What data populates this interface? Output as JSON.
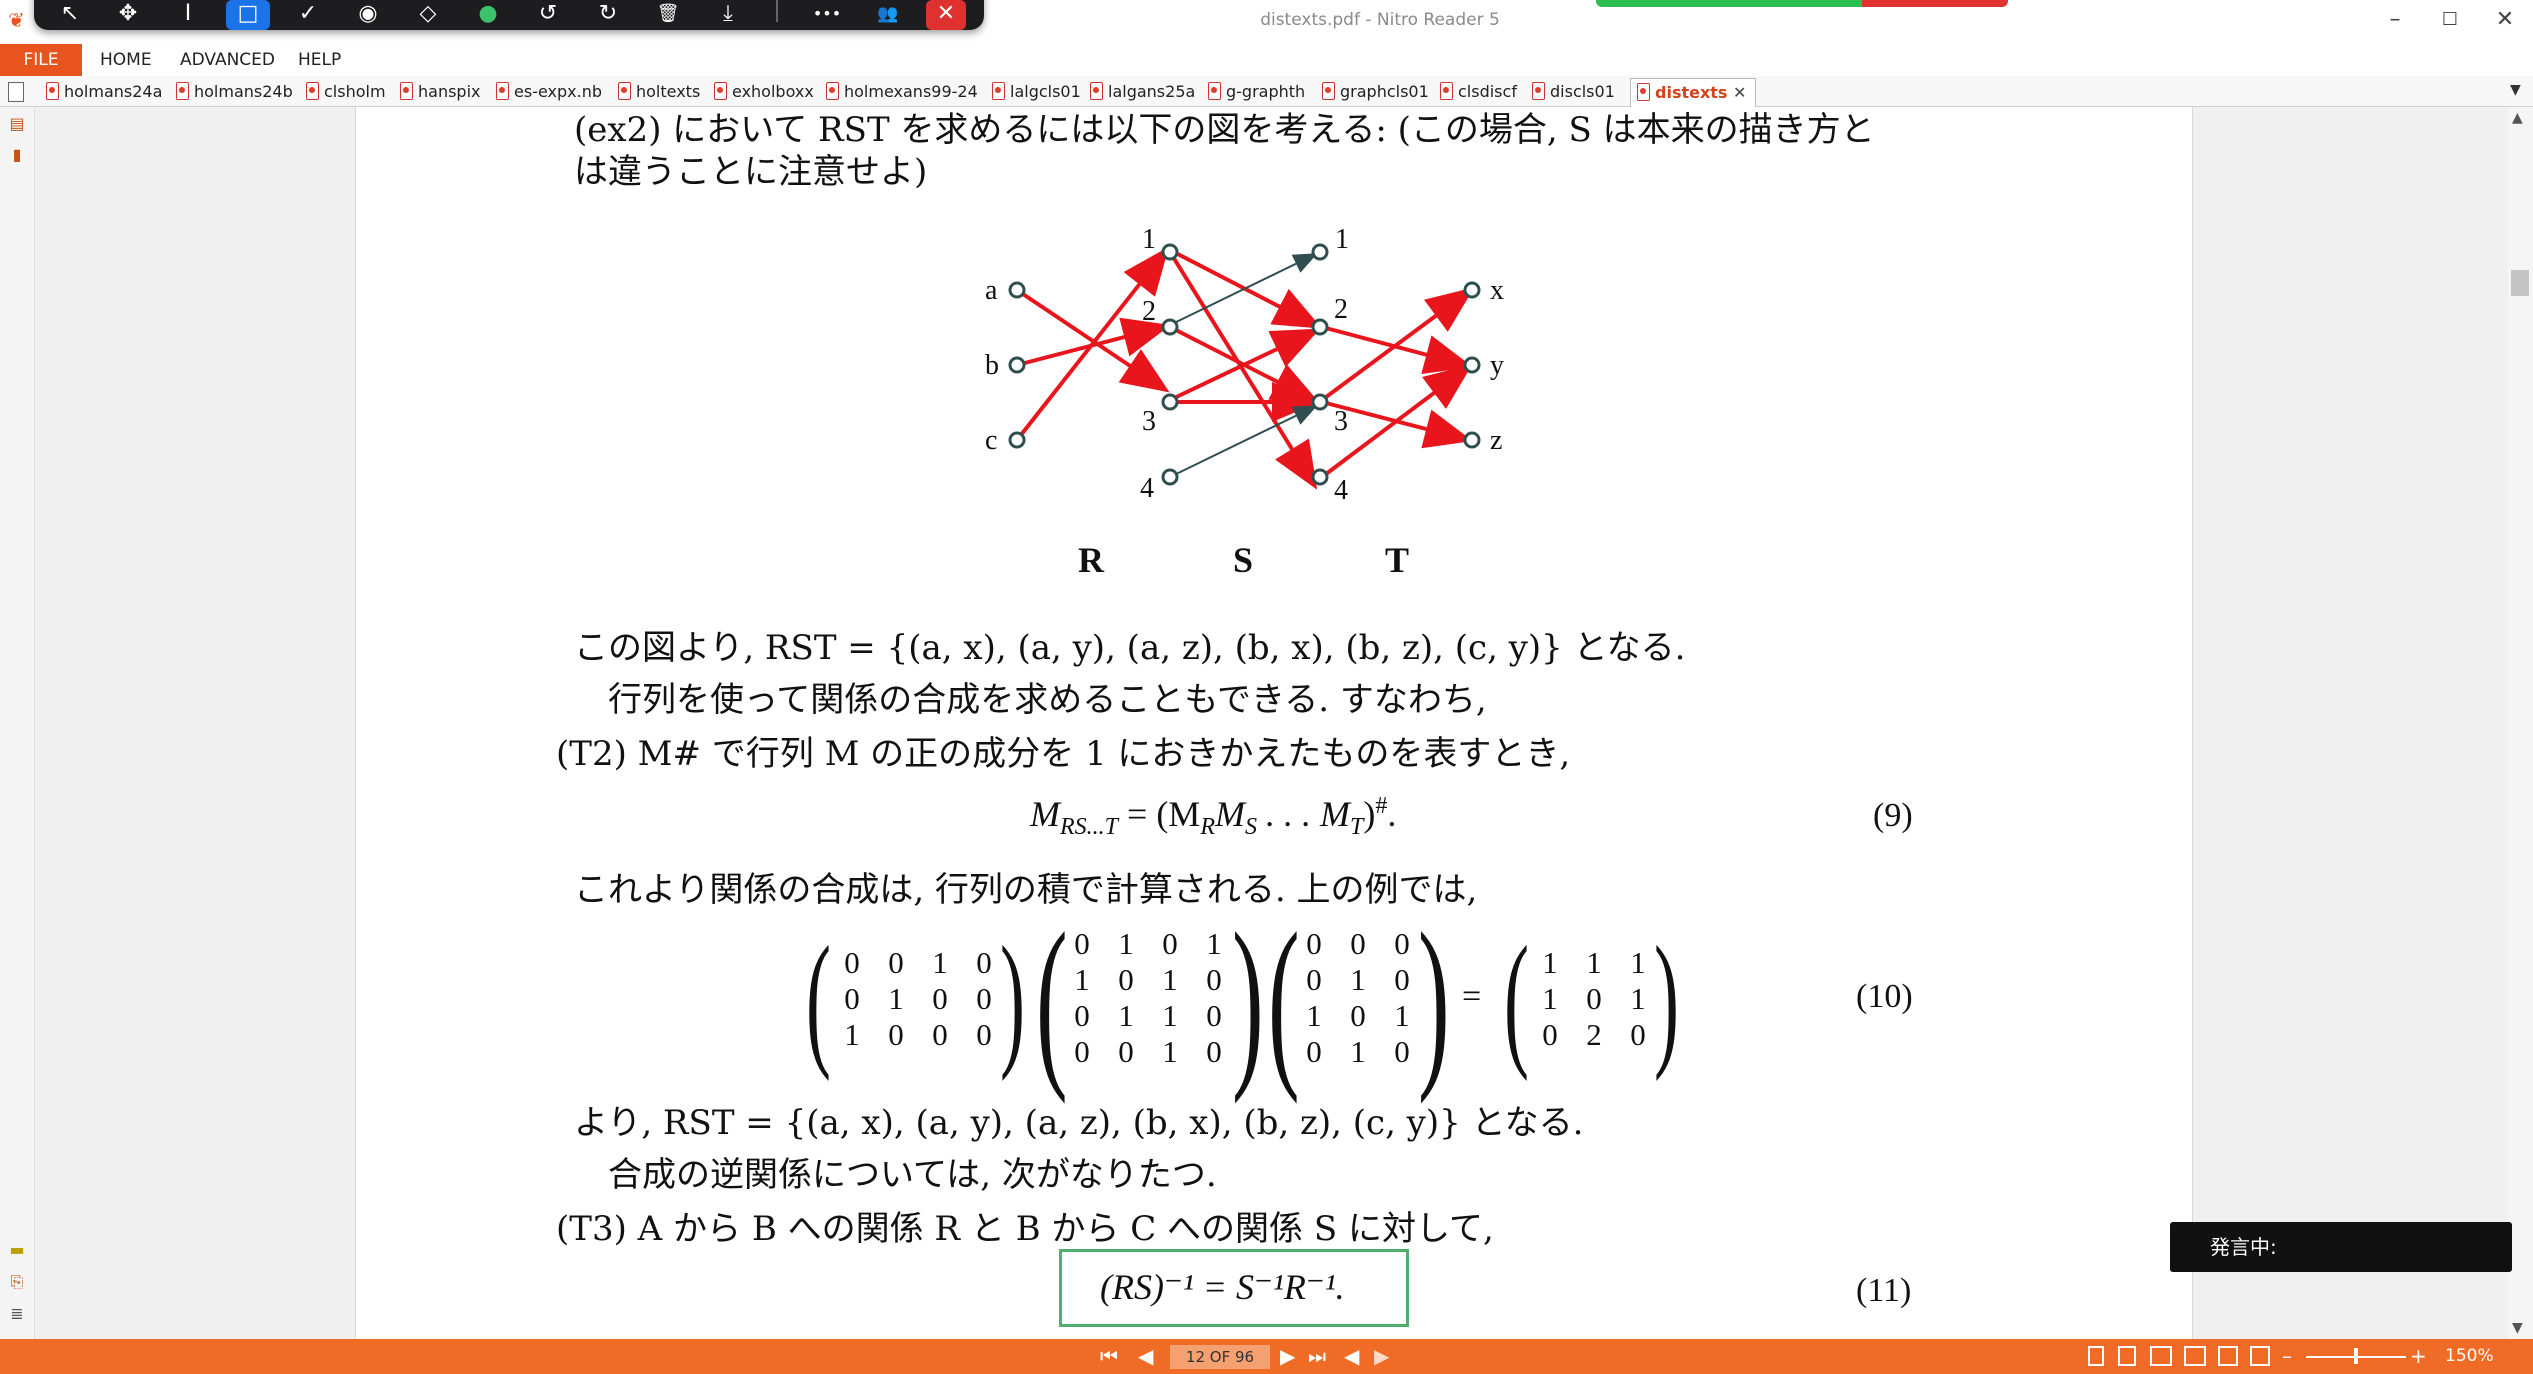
{
  "window": {
    "title": "distexts.pdf - Nitro Reader 5",
    "minimize": "–",
    "maximize": "☐",
    "close": "✕"
  },
  "toolbar": {
    "select": "↖",
    "move": "✥",
    "text": "I",
    "rect": "□",
    "check": "✓",
    "stamp": "◉",
    "eraser": "◇",
    "dot": "●",
    "undo": "↺",
    "redo": "↻",
    "delete": "🗑",
    "download": "⤓",
    "more": "•••",
    "user": "👥",
    "close": "✕"
  },
  "menu": {
    "file": "FILE",
    "home": "HOME",
    "advanced": "ADVANCED",
    "help": "HELP"
  },
  "tabs": [
    "holmans24a",
    "holmans24b",
    "clsholm",
    "hanspix",
    "es-expx.nb",
    "holtexts",
    "exholboxx",
    "holmexans99-24",
    "lalgcls01",
    "lalgans25a",
    "g-graphth",
    "graphcls01",
    "clsdiscf",
    "discls01"
  ],
  "active_tab": "distexts",
  "tab_close": "✕",
  "doc": {
    "line1": "(ex2) において RST を求めるには以下の図を考える: (この場合, S は本来の描き方と",
    "line2": "は違うことに注意せよ)",
    "fig": {
      "R_left": [
        "a",
        "b",
        "c"
      ],
      "S_nodes": [
        "1",
        "2",
        "3",
        "4"
      ],
      "S_mid": [
        "1",
        "2",
        "3",
        "4"
      ],
      "T_right": [
        "x",
        "y",
        "z"
      ],
      "labels": [
        "R",
        "S",
        "T"
      ]
    },
    "p1": "この図より, RST = {(a, x), (a, y), (a, z), (b, x), (b, z), (c, y)} となる.",
    "p2": "行列を使って関係の合成を求めることもできる. すなわち,",
    "t2": "(T2)  M# で行列 M の正の成分を 1 におきかえたものを表すとき,",
    "eq9": "M_RS…T = (M_R M_S … M_T)#.",
    "eq9_parts": {
      "lhs": "M",
      "lhs_sub": "RS...T",
      "mid": " = (M",
      "r": "R",
      "m": "M",
      "s": "S",
      "dots": " . . . M",
      "t": "T",
      "close": ")",
      "sharp": "#",
      "dot": "."
    },
    "eq9_num": "(9)",
    "p3": "これより関係の合成は, 行列の積で計算される. 上の例では,",
    "m1": [
      [
        "0",
        "0",
        "1",
        "0"
      ],
      [
        "0",
        "1",
        "0",
        "0"
      ],
      [
        "1",
        "0",
        "0",
        "0"
      ]
    ],
    "m2": [
      [
        "0",
        "1",
        "0",
        "1"
      ],
      [
        "1",
        "0",
        "1",
        "0"
      ],
      [
        "0",
        "1",
        "1",
        "0"
      ],
      [
        "0",
        "0",
        "1",
        "0"
      ]
    ],
    "m3": [
      [
        "0",
        "0",
        "0"
      ],
      [
        "0",
        "1",
        "0"
      ],
      [
        "1",
        "0",
        "1"
      ],
      [
        "0",
        "1",
        "0"
      ]
    ],
    "m4": [
      [
        "1",
        "1",
        "1"
      ],
      [
        "1",
        "0",
        "1"
      ],
      [
        "0",
        "2",
        "0"
      ]
    ],
    "eq10_equals": "=",
    "eq10_num": "(10)",
    "p4": "より, RST = {(a, x), (a, y), (a, z), (b, x), (b, z), (c, y)} となる.",
    "p5": "合成の逆関係については, 次がなりたつ.",
    "t3": "(T3)  A から B への関係 R と B から C への関係 S に対して,",
    "eq11": "(RS)⁻¹ = S⁻¹R⁻¹.",
    "eq11_num": "(11)"
  },
  "speech": "発言中:",
  "status": {
    "first": "⏮",
    "prev": "◀",
    "page": "12 OF 96",
    "next": "▶",
    "last": "⏭",
    "back": "◀",
    "forward": "▶",
    "zoom": "150%",
    "zoom_minus": "–",
    "zoom_plus": "+"
  }
}
